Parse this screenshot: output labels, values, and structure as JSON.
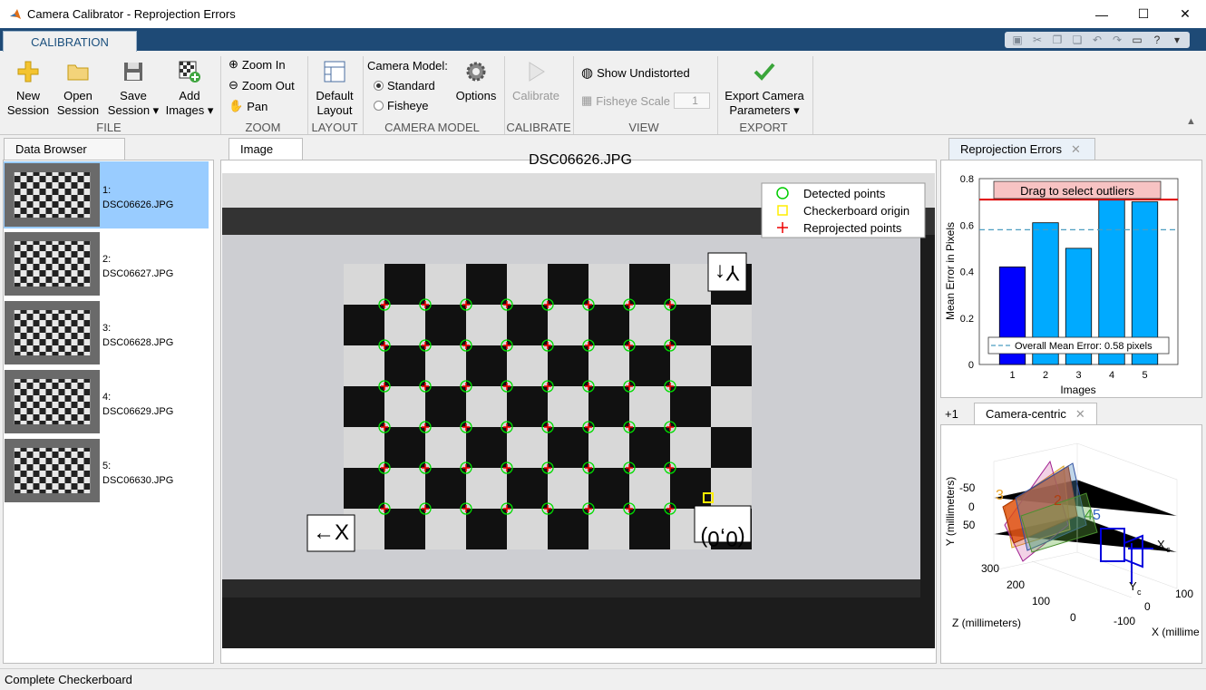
{
  "window": {
    "title": "Camera Calibrator - Reprojection Errors",
    "minimize": "—",
    "maximize": "☐",
    "close": "✕"
  },
  "tabs": {
    "calibration": "CALIBRATION"
  },
  "toolbar": {
    "file": {
      "new": "New\nSession",
      "open": "Open\nSession",
      "save": "Save\nSession ▾",
      "add": "Add\nImages ▾",
      "group": "FILE"
    },
    "zoom": {
      "zoom_in": "Zoom In",
      "zoom_out": "Zoom Out",
      "pan": "Pan",
      "group": "ZOOM"
    },
    "layout": {
      "default": "Default\nLayout",
      "group": "LAYOUT"
    },
    "camera_model": {
      "label": "Camera Model:",
      "standard": "Standard",
      "fisheye": "Fisheye",
      "options": "Options",
      "group": "CAMERA MODEL"
    },
    "calibrate": {
      "label": "Calibrate",
      "group": "CALIBRATE"
    },
    "view": {
      "show_undistorted": "Show Undistorted",
      "fisheye_scale": "Fisheye Scale",
      "fisheye_scale_value": "1",
      "group": "VIEW"
    },
    "export": {
      "label": "Export Camera\nParameters ▾",
      "group": "EXPORT"
    }
  },
  "data_browser": {
    "tab": "Data Browser",
    "items": [
      {
        "index": "1:",
        "name": "DSC06626.JPG",
        "selected": true
      },
      {
        "index": "2:",
        "name": "DSC06627.JPG",
        "selected": false
      },
      {
        "index": "3:",
        "name": "DSC06628.JPG",
        "selected": false
      },
      {
        "index": "4:",
        "name": "DSC06629.JPG",
        "selected": false
      },
      {
        "index": "5:",
        "name": "DSC06630.JPG",
        "selected": false
      }
    ]
  },
  "image_panel": {
    "tab": "Image",
    "image_title": "DSC06626.JPG",
    "legend": {
      "detected": "Detected points",
      "origin": "Checkerboard origin",
      "reprojected": "Reprojected points"
    },
    "axis_x": "←X",
    "axis_y": "Y↑",
    "origin_label": "(0,0)"
  },
  "reprojection_panel": {
    "tab": "Reprojection Errors",
    "outlier_hint": "Drag to select outliers",
    "legend": "Overall Mean Error: 0.58 pixels"
  },
  "extrinsics_panel": {
    "tab": "Camera-centric",
    "tab_more": "+1",
    "ylabel": "Y (millimeters)",
    "zlabel": "Z (millimeters)",
    "xlabel": "X (millime",
    "y_ticks": [
      "-50",
      "0",
      "50"
    ],
    "z_ticks": [
      "300",
      "200",
      "100",
      "0"
    ],
    "x_ticks": [
      "100",
      "0",
      "-100"
    ],
    "plane_labels": [
      "3",
      "2",
      "4",
      "5"
    ],
    "cam_labels": {
      "z": "Z",
      "x": "X",
      "y": "Y",
      "c1": "c",
      "c2": "c"
    }
  },
  "status": {
    "text": "Complete Checkerboard"
  },
  "colors": {
    "accent": "#1e4a76",
    "bar_selected": "#0000ff",
    "bar": "#00aaff",
    "threshold": "#e00000",
    "mean_line": "#4c9ec0"
  },
  "chart_data": {
    "type": "bar",
    "categories": [
      "1",
      "2",
      "3",
      "4",
      "5"
    ],
    "values": [
      0.42,
      0.61,
      0.5,
      0.71,
      0.7
    ],
    "title": "",
    "xlabel": "Images",
    "ylabel": "Mean Error in Pixels",
    "ylim": [
      0,
      0.8
    ],
    "yticks": [
      "0",
      "0.2",
      "0.4",
      "0.6",
      "0.8"
    ],
    "overall_mean": 0.58,
    "outlier_threshold": 0.71,
    "selected_index": 0
  }
}
